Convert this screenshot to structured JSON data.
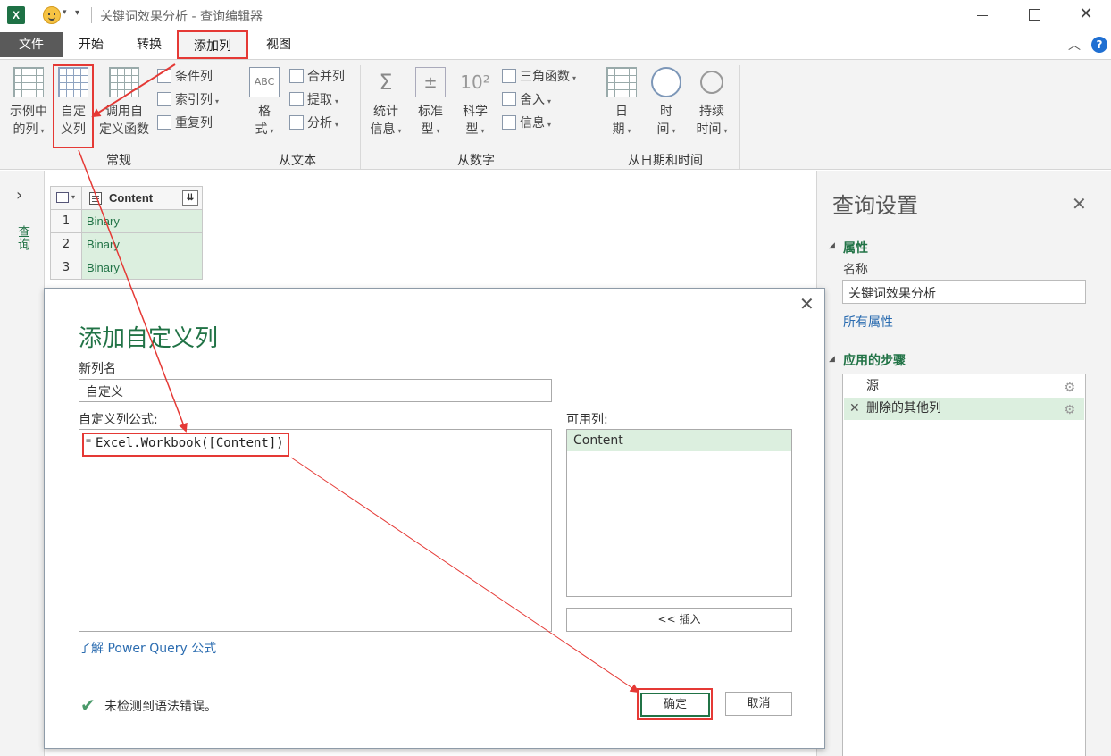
{
  "window": {
    "app_icon_text": "X",
    "title": "关键词效果分析 - 查询编辑器",
    "close_glyph": "✕"
  },
  "ribbon_tabs": [
    "文件",
    "开始",
    "转换",
    "添加列",
    "视图"
  ],
  "ribbon": {
    "general": {
      "group_label": "常规",
      "column_from_examples": [
        "示例中",
        "的列"
      ],
      "custom_column": [
        "自定",
        "义列"
      ],
      "invoke_custom_function": [
        "调用自",
        "定义函数"
      ],
      "conditional_column": "条件列",
      "index_column": "索引列",
      "duplicate_column": "重复列"
    },
    "from_text": {
      "group_label": "从文本",
      "format": [
        "格",
        "式"
      ],
      "merge_columns": "合并列",
      "extract": "提取",
      "parse": "分析"
    },
    "from_number": {
      "group_label": "从数字",
      "statistics": [
        "统计",
        "信息"
      ],
      "standard": [
        "标准",
        "型"
      ],
      "scientific": [
        "科学",
        "型"
      ],
      "trigonometry": "三角函数",
      "rounding": "舍入",
      "information": "信息"
    },
    "from_datetime": {
      "group_label": "从日期和时间",
      "date": [
        "日",
        "期"
      ],
      "time": [
        "时",
        "间"
      ],
      "duration": [
        "持续",
        "时间"
      ]
    }
  },
  "queries_panel": {
    "vertical_label": "查询"
  },
  "data_grid": {
    "column_header": "Content",
    "rows": [
      {
        "num": "1",
        "value": "Binary"
      },
      {
        "num": "2",
        "value": "Binary"
      },
      {
        "num": "3",
        "value": "Binary"
      }
    ]
  },
  "query_settings": {
    "title": "查询设置",
    "properties_heading": "属性",
    "name_label": "名称",
    "name_value": "关键词效果分析",
    "all_properties_link": "所有属性",
    "applied_steps_heading": "应用的步骤",
    "steps": [
      "源",
      "删除的其他列"
    ]
  },
  "dialog": {
    "title": "添加自定义列",
    "new_column_name_label": "新列名",
    "new_column_name_value": "自定义",
    "formula_label": "自定义列公式:",
    "formula_eq": "=",
    "formula_value": "Excel.Workbook([Content])",
    "available_columns_label": "可用列:",
    "available_columns": [
      "Content"
    ],
    "insert_button": "<< 插入",
    "learn_link": "了解 Power Query 公式",
    "status_text": "未检测到语法错误。",
    "ok_button": "确定",
    "cancel_button": "取消"
  },
  "annotation_color": "#e53935",
  "accent_color": "#217346"
}
